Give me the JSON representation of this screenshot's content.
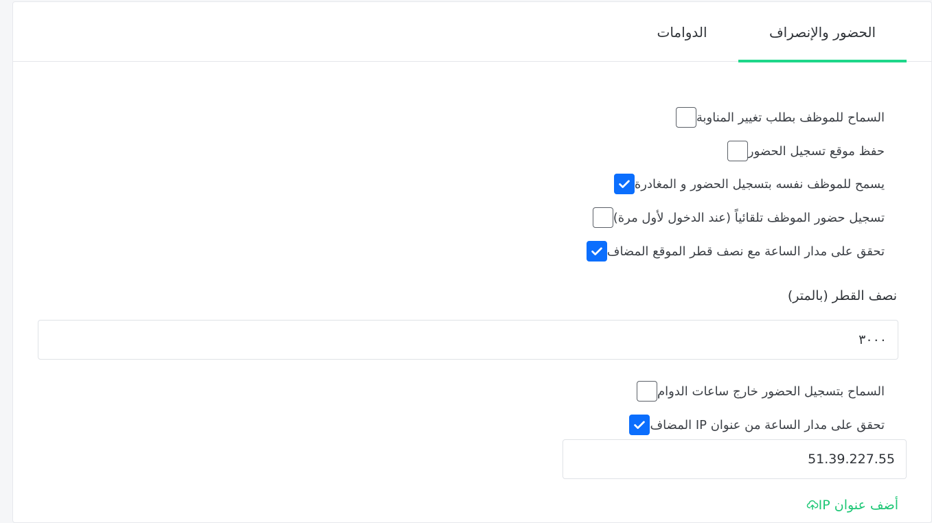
{
  "tabs": {
    "attendance": "الحضور والإنصراف",
    "shifts": "الدوامات"
  },
  "options": [
    {
      "label": "السماح للموظف بطلب تغيير المناوبة",
      "checked": false
    },
    {
      "label": "حفظ موقع تسجيل الحضور",
      "checked": false
    },
    {
      "label": "يسمح للموظف نفسه بتسجيل الحضور و المغادرة",
      "checked": true
    },
    {
      "label": "تسجيل حضور الموظف تلقائياً (عند الدخول لأول مرة)",
      "checked": false
    },
    {
      "label": "تحقق على مدار الساعة مع نصف قطر الموقع المضاف",
      "checked": true
    }
  ],
  "radius": {
    "label": "نصف القطر (بالمتر)",
    "value": "٣٠٠٠"
  },
  "options2": [
    {
      "label": "السماح بتسجيل الحضور خارج ساعات الدوام",
      "checked": false
    },
    {
      "label": "تحقق على مدار الساعة من عنوان IP المضاف",
      "checked": true
    }
  ],
  "ip": {
    "value": "51.39.227.55"
  },
  "add_ip": {
    "label": "أضف عنوان IP",
    "icon": "cloud-upload-icon"
  },
  "colors": {
    "accent_green": "#1ed78a",
    "checkbox_blue": "#0b6efd"
  }
}
